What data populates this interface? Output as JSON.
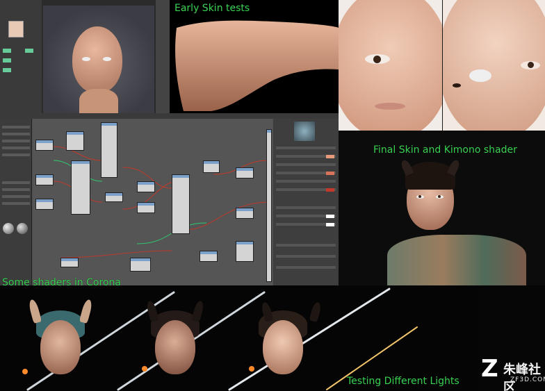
{
  "captions": {
    "early": "Early Skin tests",
    "final": "Final Skin and Kimono shader",
    "shaders": "Some shaders in Corona",
    "lights": "Testing Different Lights"
  },
  "watermark": {
    "name": "朱峰社区",
    "url": "ZF3D.COM"
  },
  "colors": {
    "caption": "#39d353",
    "skin": "#e2b39a",
    "node_header": "#7ba0c9"
  }
}
